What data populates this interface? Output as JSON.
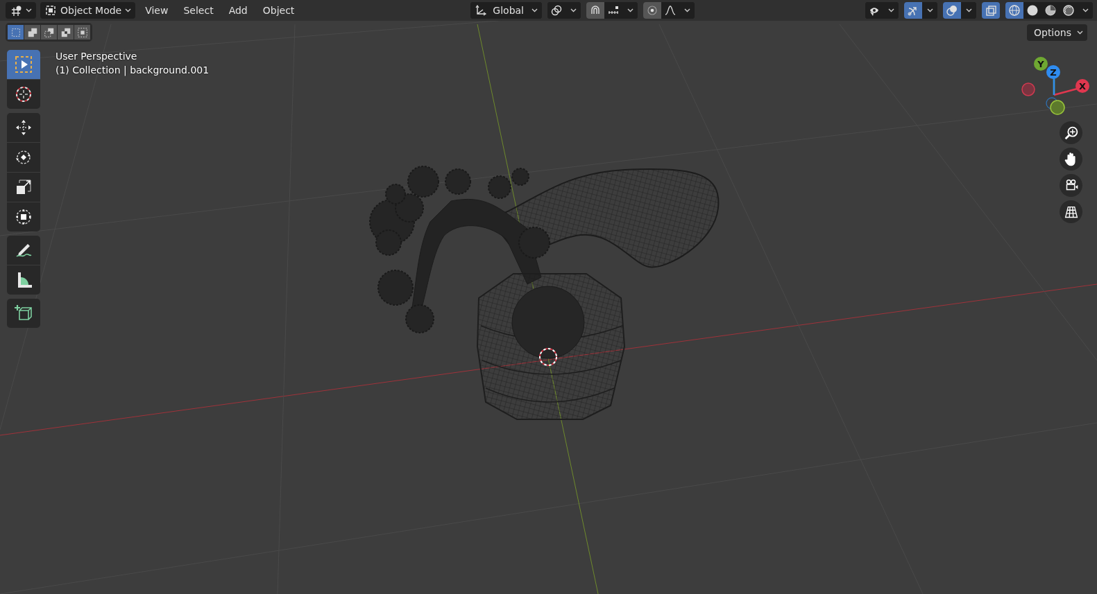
{
  "header": {
    "editor": {
      "kind": "editor-type"
    },
    "mode": {
      "label": "Object Mode"
    },
    "menus": [
      "View",
      "Select",
      "Add",
      "Object"
    ],
    "center_groups": [
      {
        "dropdown": true,
        "items": [
          {
            "kind": "orientation",
            "label": "Global"
          }
        ]
      },
      {
        "dropdown": true,
        "items": [
          {
            "kind": "pivot"
          }
        ]
      },
      {
        "dropdown": true,
        "items": [
          {
            "kind": "snap",
            "on": true
          },
          {
            "kind": "snap-increment",
            "on": false
          }
        ]
      },
      {
        "dropdown": true,
        "items": [
          {
            "kind": "proportional",
            "on": true
          },
          {
            "kind": "falloff",
            "on": false
          }
        ]
      }
    ],
    "right_groups": [
      {
        "dropdown": true,
        "items": [
          {
            "kind": "visibility",
            "on": false
          }
        ]
      },
      {
        "dropdown": true,
        "items": [
          {
            "kind": "gizmo",
            "on": true
          }
        ]
      },
      {
        "dropdown": true,
        "items": [
          {
            "kind": "overlays",
            "on": true
          }
        ]
      },
      {
        "dropdown": false,
        "items": [
          {
            "kind": "xray",
            "on": true
          }
        ]
      },
      {
        "dropdown": true,
        "items": [
          {
            "kind": "wireframe",
            "on": true
          },
          {
            "kind": "solid",
            "on": false
          },
          {
            "kind": "material",
            "on": false
          },
          {
            "kind": "rendered",
            "on": false
          }
        ]
      }
    ]
  },
  "select_modes": [
    {
      "kind": "new",
      "selected": true
    },
    {
      "kind": "extend",
      "selected": false
    },
    {
      "kind": "subtract",
      "selected": false
    },
    {
      "kind": "invert",
      "selected": false
    },
    {
      "kind": "intersect",
      "selected": false
    }
  ],
  "options": {
    "label": "Options"
  },
  "viewport_info": [
    "User Perspective",
    "(1) Collection | background.001"
  ],
  "tool_groups": [
    [
      {
        "kind": "select-box",
        "selected": true
      },
      {
        "kind": "cursor",
        "selected": false
      }
    ],
    [
      {
        "kind": "move",
        "selected": false
      },
      {
        "kind": "rotate",
        "selected": false
      },
      {
        "kind": "scale",
        "selected": false
      },
      {
        "kind": "transform",
        "selected": false
      }
    ],
    [
      {
        "kind": "annotate",
        "selected": false
      },
      {
        "kind": "measure",
        "selected": false
      }
    ],
    [
      {
        "kind": "add-cube",
        "selected": false
      }
    ]
  ],
  "gizmo": {
    "axes": [
      {
        "label": "Y",
        "color": "#6fa832"
      },
      {
        "label": "Z",
        "color": "#2f8cf0"
      },
      {
        "label": "X",
        "color": "#e0374f"
      }
    ]
  },
  "navigation": [
    {
      "kind": "zoom"
    },
    {
      "kind": "pan"
    },
    {
      "kind": "camera"
    },
    {
      "kind": "ortho"
    }
  ]
}
